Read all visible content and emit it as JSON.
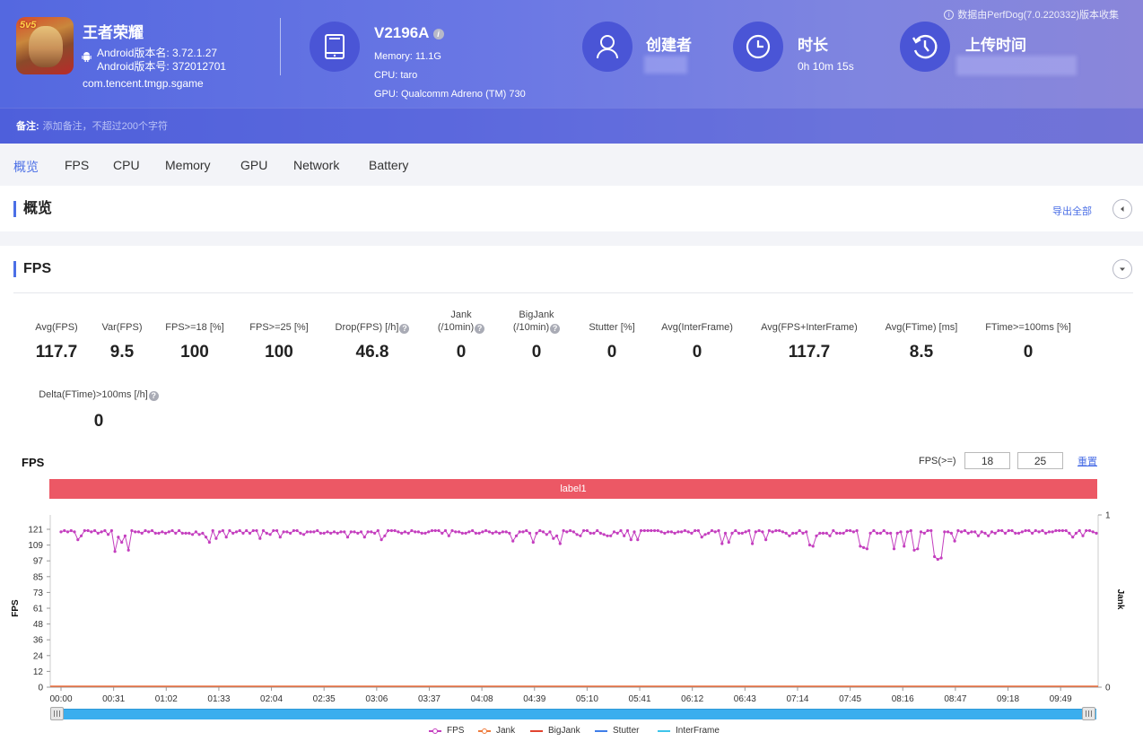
{
  "app": {
    "name": "王者荣耀",
    "version_name": "Android版本名: 3.72.1.27",
    "version_code": "Android版本号: 372012701",
    "package": "com.tencent.tmgp.sgame",
    "icon_badge": "5v5"
  },
  "device": {
    "model": "V2196A",
    "memory": "Memory: 11.1G",
    "cpu": "CPU: taro",
    "gpu": "GPU: Qualcomm Adreno (TM) 730"
  },
  "creator": {
    "title": "创建者"
  },
  "duration": {
    "title": "时长",
    "value": "0h 10m 15s"
  },
  "upload_time": {
    "title": "上传时间"
  },
  "collect_note": "数据由PerfDog(7.0.220332)版本收集",
  "remark": {
    "label": "备注:",
    "placeholder": "添加备注，不超过200个字符"
  },
  "tabs": [
    {
      "label": "概览",
      "active": true
    },
    {
      "label": "FPS"
    },
    {
      "label": "CPU"
    },
    {
      "label": "Memory"
    },
    {
      "label": "GPU"
    },
    {
      "label": "Network"
    },
    {
      "label": "Battery"
    }
  ],
  "overview": {
    "title": "概览",
    "export_label": "导出全部"
  },
  "fps_section": {
    "title": "FPS",
    "metrics": [
      {
        "label": "Avg(FPS)",
        "value": "117.7"
      },
      {
        "label": "Var(FPS)",
        "value": "9.5"
      },
      {
        "label": "FPS>=18 [%]",
        "value": "100"
      },
      {
        "label": "FPS>=25 [%]",
        "value": "100"
      },
      {
        "label": "Drop(FPS) [/h]",
        "value": "46.8",
        "help": true
      },
      {
        "label": "Jank",
        "label2": "(/10min)",
        "value": "0",
        "help": true
      },
      {
        "label": "BigJank",
        "label2": "(/10min)",
        "value": "0",
        "help": true
      },
      {
        "label": "Stutter [%]",
        "value": "0"
      },
      {
        "label": "Avg(InterFrame)",
        "value": "0"
      },
      {
        "label": "Avg(FPS+InterFrame)",
        "value": "117.7"
      },
      {
        "label": "Avg(FTime) [ms]",
        "value": "8.5"
      },
      {
        "label": "FTime>=100ms [%]",
        "value": "0"
      },
      {
        "label": "Delta(FTime)>100ms [/h]",
        "value": "0",
        "help": true
      }
    ],
    "help_glyph": "?"
  },
  "chart_controls": {
    "title": "FPS",
    "threshold_label": "FPS(>=)",
    "threshold_1": "18",
    "threshold_2": "25",
    "reset_label": "重置",
    "label_bar": "label1",
    "label_color": "#ec5865"
  },
  "chart_data": {
    "type": "line",
    "title": "FPS",
    "ylabel": "FPS",
    "y2label": "Jank",
    "ylim": [
      0,
      121
    ],
    "y_ticks": [
      "0",
      "12",
      "24",
      "36",
      "48",
      "61",
      "73",
      "85",
      "97",
      "109",
      "121"
    ],
    "y2lim": [
      0,
      1
    ],
    "y2_ticks": [
      "0",
      "1"
    ],
    "x_ticks": [
      "00:00",
      "00:31",
      "01:02",
      "01:33",
      "02:04",
      "02:35",
      "03:06",
      "03:37",
      "04:08",
      "04:39",
      "05:10",
      "05:41",
      "06:12",
      "06:43",
      "07:14",
      "07:45",
      "08:16",
      "08:47",
      "09:18",
      "09:49"
    ],
    "duration_seconds": 615,
    "grid": false,
    "legend_position": "bottom",
    "series": [
      {
        "name": "FPS",
        "color": "#c43fbf",
        "marker": true,
        "baseline": 120,
        "dips": [
          [
            10,
            113
          ],
          [
            28,
            117
          ],
          [
            32,
            104
          ],
          [
            34,
            115
          ],
          [
            36,
            111
          ],
          [
            38,
            116
          ],
          [
            40,
            109
          ],
          [
            62,
            118
          ],
          [
            82,
            117
          ],
          [
            88,
            111
          ],
          [
            92,
            114
          ],
          [
            98,
            115
          ],
          [
            118,
            117
          ],
          [
            155,
            118
          ],
          [
            190,
            117
          ],
          [
            203,
            118
          ],
          [
            230,
            116
          ],
          [
            266,
            118
          ],
          [
            268,
            112
          ],
          [
            270,
            116
          ],
          [
            281,
            111
          ],
          [
            293,
            114
          ],
          [
            297,
            110
          ],
          [
            322,
            117
          ],
          [
            338,
            113
          ],
          [
            342,
            113
          ],
          [
            392,
            110
          ],
          [
            396,
            111
          ],
          [
            410,
            110
          ],
          [
            418,
            113
          ],
          [
            444,
            109
          ],
          [
            446,
            108
          ],
          [
            474,
            108
          ],
          [
            476,
            107
          ],
          [
            478,
            106
          ],
          [
            495,
            110
          ],
          [
            501,
            108
          ],
          [
            506,
            105
          ],
          [
            508,
            106
          ],
          [
            518,
            100
          ],
          [
            520,
            98
          ],
          [
            522,
            99
          ],
          [
            530,
            112
          ],
          [
            545,
            116
          ],
          [
            600,
            115
          ],
          [
            606,
            116
          ],
          [
            640,
            117
          ],
          [
            660,
            116
          ],
          [
            670,
            115
          ],
          [
            690,
            114
          ],
          [
            700,
            114
          ],
          [
            720,
            113
          ]
        ]
      },
      {
        "name": "Jank",
        "color": "#ee7b3c",
        "marker": true,
        "values": "all 0"
      },
      {
        "name": "BigJank",
        "color": "#e2442f",
        "marker": false,
        "values": "all 0"
      },
      {
        "name": "Stutter",
        "color": "#3f7ee8",
        "marker": false,
        "values": "all 0"
      },
      {
        "name": "InterFrame",
        "color": "#3ec4ea",
        "marker": false,
        "values": "all 0"
      }
    ],
    "range_slider": {
      "start": 0,
      "end": 1
    }
  }
}
